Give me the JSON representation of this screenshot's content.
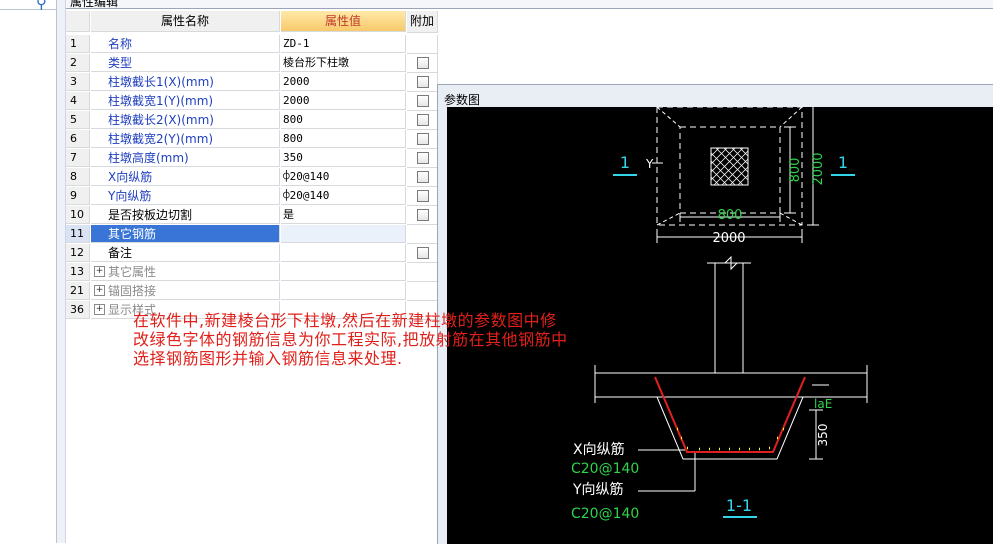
{
  "panel_tab_label": "属性编辑",
  "grid": {
    "headers": {
      "no": "",
      "name": "属性名称",
      "value": "属性值",
      "add": "附加"
    },
    "rows": [
      {
        "no": "1",
        "name": "名称",
        "value": "ZD-1"
      },
      {
        "no": "2",
        "name": "类型",
        "value": "棱台形下柱墩"
      },
      {
        "no": "3",
        "name": "柱墩截长1(X)(mm)",
        "value": "2000"
      },
      {
        "no": "4",
        "name": "柱墩截宽1(Y)(mm)",
        "value": "2000"
      },
      {
        "no": "5",
        "name": "柱墩截长2(X)(mm)",
        "value": "800"
      },
      {
        "no": "6",
        "name": "柱墩截宽2(Y)(mm)",
        "value": "800"
      },
      {
        "no": "7",
        "name": "柱墩高度(mm)",
        "value": "350"
      },
      {
        "no": "8",
        "name": "X向纵筋",
        "value": "⌽20@140"
      },
      {
        "no": "9",
        "name": "Y向纵筋",
        "value": "⌽20@140"
      },
      {
        "no": "10",
        "name": "是否按板边切割",
        "value": "是"
      },
      {
        "no": "11",
        "name": "其它钢筋",
        "value": ""
      },
      {
        "no": "12",
        "name": "备注",
        "value": ""
      },
      {
        "no": "13",
        "name": "其它属性",
        "value": ""
      },
      {
        "no": "21",
        "name": "锚固搭接",
        "value": ""
      },
      {
        "no": "36",
        "name": "显示样式",
        "value": ""
      }
    ]
  },
  "annotation": "在软件中,新建棱台形下柱墩,然后在新建柱墩的参数图中修改绿色字体的钢筋信息为你工程实际,把放射筋在其他钢筋中选择钢筋图形并输入钢筋信息来处理.",
  "param_window": {
    "title": "参数图",
    "drawing": {
      "section_mark": "1",
      "y_label": "Y",
      "dim_800_v": "800",
      "dim_2000_v": "2000",
      "dim_800_h": "800",
      "dim_2000_h": "2000",
      "lae_label": "laE",
      "dim_350": "350",
      "x_bar_label": "X向纵筋",
      "x_bar_value": "C20@140",
      "y_bar_label": "Y向纵筋",
      "y_bar_value": "C20@140",
      "section_title": "1-1"
    }
  },
  "colors": {
    "drawing_green": "#2fd34b",
    "rebar_red": "#e02020",
    "dim_white": "#ffffff",
    "section_cyan": "#33d6e8",
    "annotation_red": "#e0201a"
  }
}
